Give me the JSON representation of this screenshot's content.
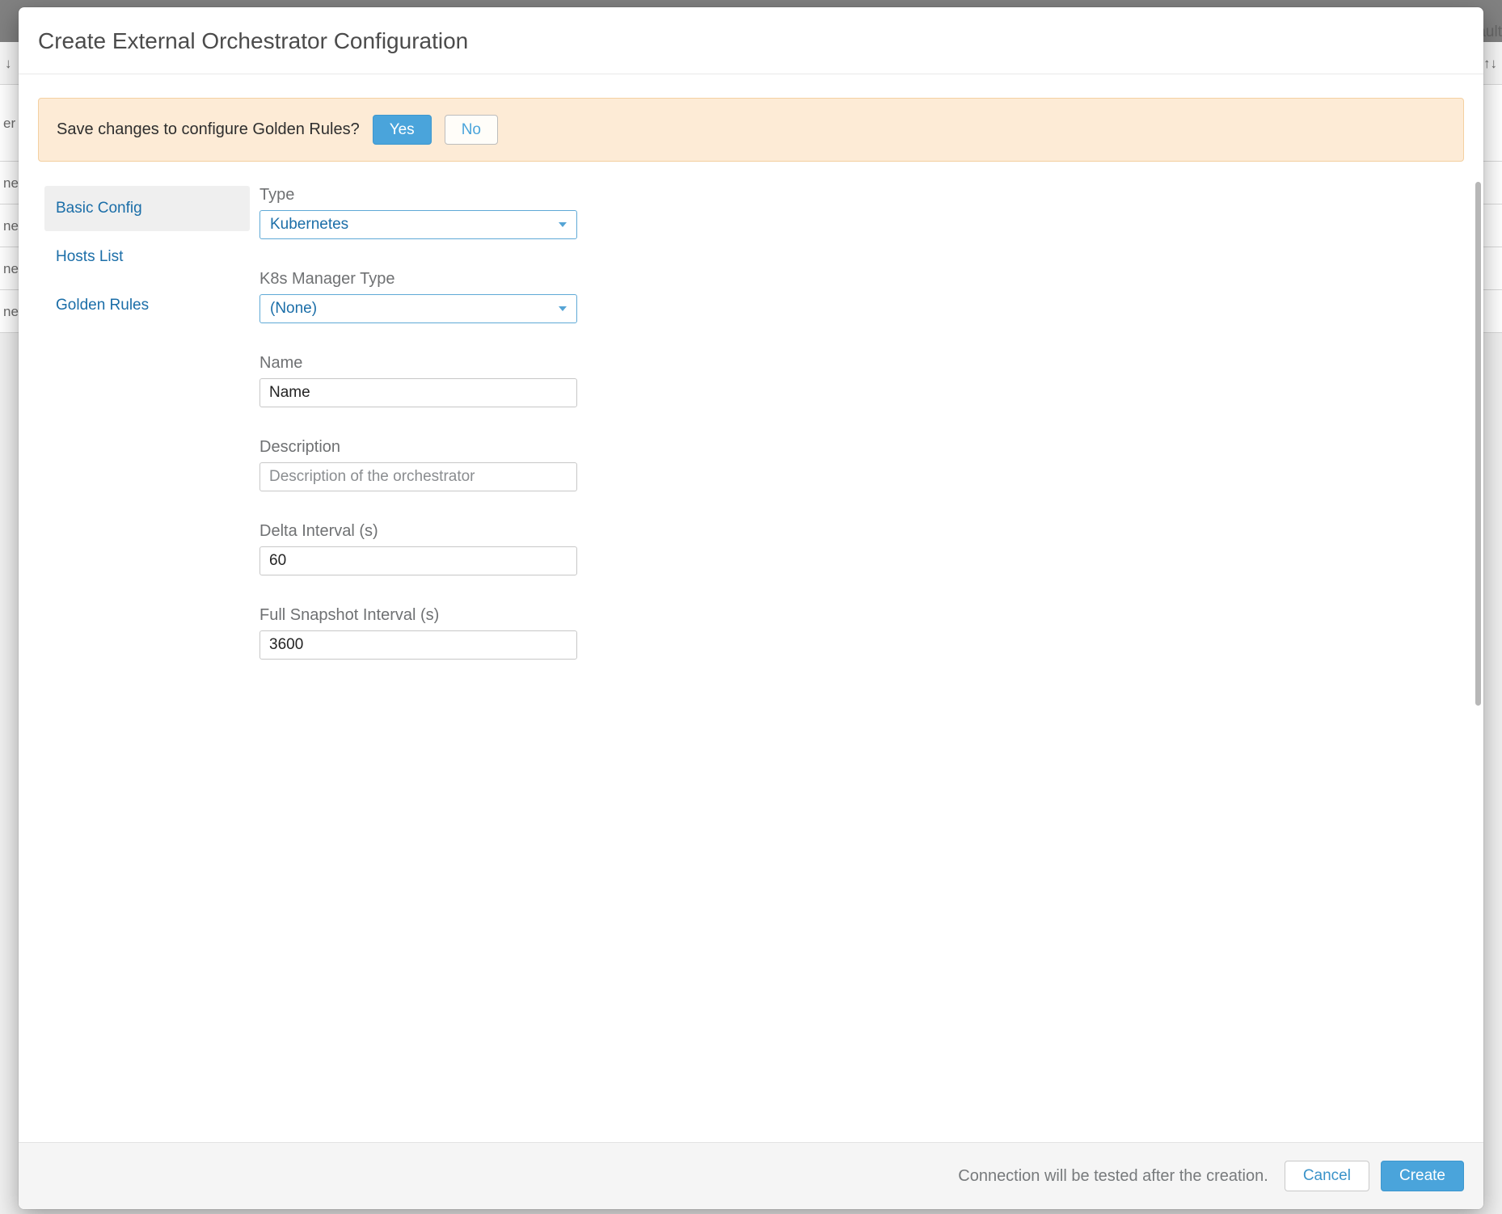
{
  "background": {
    "header_right_hint": "ault",
    "sort_hint_left": "↓",
    "sort_hint_right": "↑↓",
    "row_hints": [
      "",
      "er",
      "ne",
      "ne",
      "ne",
      "ne"
    ]
  },
  "modal": {
    "title": "Create External Orchestrator Configuration",
    "alert": {
      "text": "Save changes to configure Golden Rules?",
      "yes_label": "Yes",
      "no_label": "No"
    },
    "sidebar": {
      "items": [
        {
          "label": "Basic Config",
          "active": true
        },
        {
          "label": "Hosts List",
          "active": false
        },
        {
          "label": "Golden Rules",
          "active": false
        }
      ]
    },
    "form": {
      "type": {
        "label": "Type",
        "value": "Kubernetes"
      },
      "k8s_manager_type": {
        "label": "K8s Manager Type",
        "value": "(None)"
      },
      "name": {
        "label": "Name",
        "value": "Name"
      },
      "description": {
        "label": "Description",
        "value": "",
        "placeholder": "Description of the orchestrator"
      },
      "delta_interval": {
        "label": "Delta Interval (s)",
        "value": "60"
      },
      "full_snapshot_interval": {
        "label": "Full Snapshot Interval (s)",
        "value": "3600"
      }
    },
    "footer": {
      "note": "Connection will be tested after the creation.",
      "cancel_label": "Cancel",
      "create_label": "Create"
    }
  }
}
